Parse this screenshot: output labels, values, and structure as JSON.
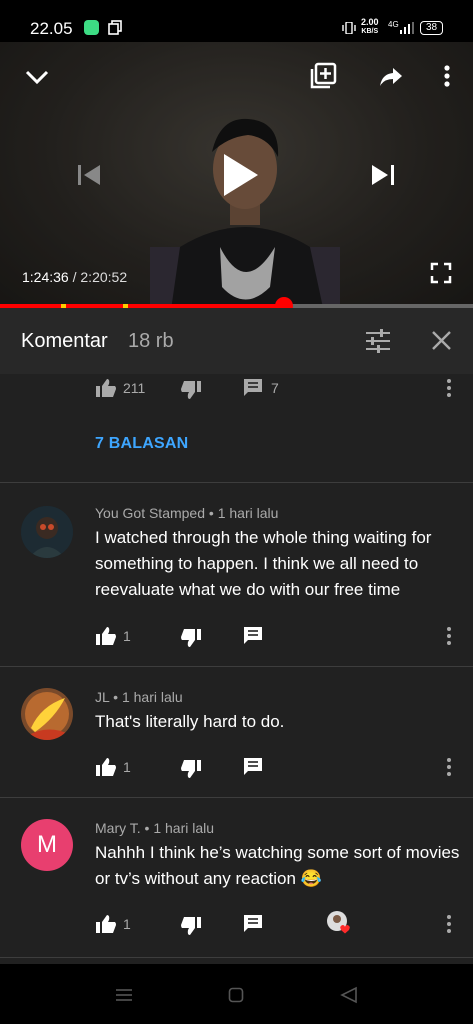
{
  "status_bar": {
    "time": "22.05",
    "speed_value": "2.00",
    "speed_unit": "KB/S",
    "network": "4G",
    "battery": "38"
  },
  "player": {
    "current_time": "1:24:36",
    "separator": " / ",
    "total_time": "2:20:52",
    "progress": 0.6,
    "ad_markers": [
      0.13,
      0.26
    ],
    "icons": [
      "chevron-down-icon",
      "add-to-playlist-icon",
      "share-icon",
      "more-vert-icon",
      "previous-icon",
      "play-icon",
      "next-icon",
      "fullscreen-icon"
    ]
  },
  "comments_header": {
    "title": "Komentar",
    "count": "18 rb"
  },
  "partial_comment": {
    "likes": "211",
    "replies": "7",
    "replies_link": "7 BALASAN"
  },
  "comments": [
    {
      "author": "You Got Stamped",
      "time": "1 hari lalu",
      "text": "I watched through the whole thing waiting for something to happen. I think we all need to reevaluate what we do with our free time",
      "likes": "1"
    },
    {
      "author": "JL",
      "time": "1 hari lalu",
      "text": "That's literally hard to do.",
      "likes": "1"
    },
    {
      "author": "Mary T.",
      "avatar_letter": "M",
      "time": "1 hari lalu",
      "text": "Nahhh I think he’s watching some sort of movies or tv’s without any reaction 😂",
      "likes": "1"
    }
  ],
  "colors": {
    "accent_link": "#3ea6ff",
    "progress": "#ff0000",
    "avatar_m": "#e83f6f"
  }
}
